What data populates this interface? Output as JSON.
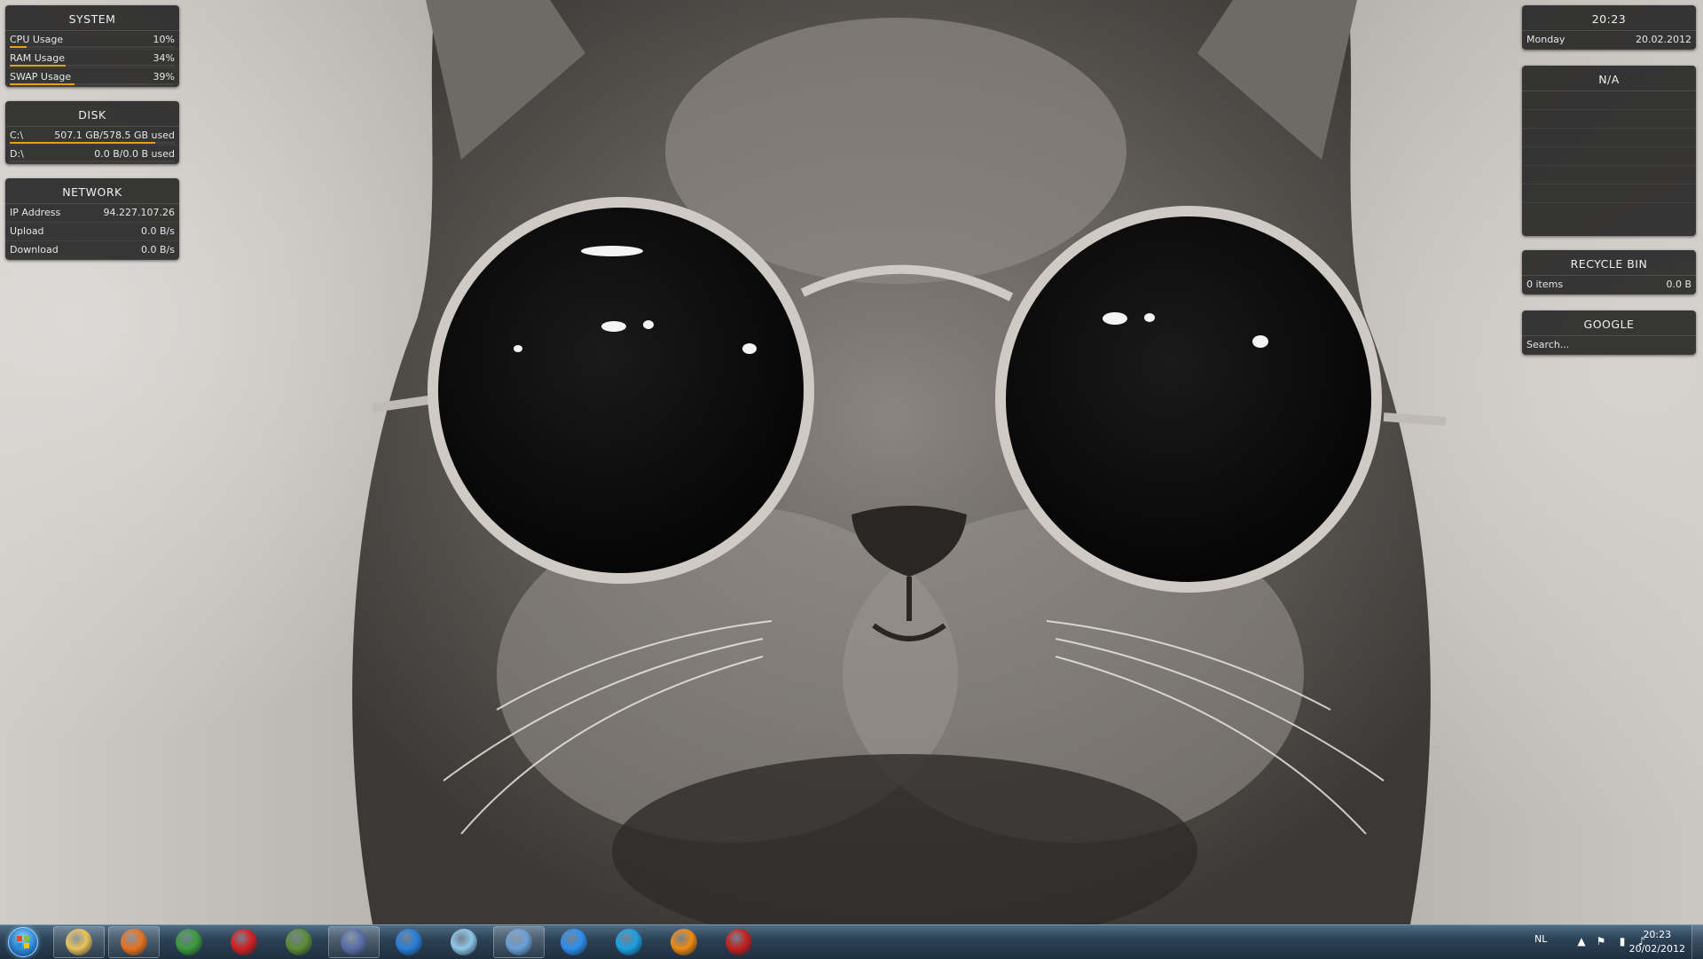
{
  "widgets": {
    "system": {
      "title": "SYSTEM",
      "rows": [
        {
          "label": "CPU Usage",
          "value": "10%",
          "fraction": 0.1
        },
        {
          "label": "RAM Usage",
          "value": "34%",
          "fraction": 0.34
        },
        {
          "label": "SWAP Usage",
          "value": "39%",
          "fraction": 0.39
        }
      ]
    },
    "disk": {
      "title": "DISK",
      "rows": [
        {
          "label": "C:\\",
          "value": "507.1 GB/578.5 GB used",
          "fraction": 0.88
        },
        {
          "label": "D:\\",
          "value": "0.0 B/0.0 B used",
          "fraction": 0.0
        }
      ]
    },
    "network": {
      "title": "NETWORK",
      "rows": [
        {
          "label": "IP Address",
          "value": "94.227.107.26"
        },
        {
          "label": "Upload",
          "value": "0.0 B/s"
        },
        {
          "label": "Download",
          "value": "0.0 B/s"
        }
      ]
    },
    "clock": {
      "time": "20:23",
      "day": "Monday",
      "date": "20.02.2012"
    },
    "weather": {
      "title": "N/A"
    },
    "recycle_bin": {
      "title": "RECYCLE BIN",
      "items": "0 items",
      "size": "0.0 B"
    },
    "google": {
      "title": "GOOGLE",
      "placeholder": "Search..."
    }
  },
  "taskbar": {
    "apps": [
      {
        "icon": "windows-explorer-icon",
        "color": "#e8c35a",
        "pinned_active": true
      },
      {
        "icon": "firefox-icon",
        "color": "#e8731f",
        "pinned_active": true
      },
      {
        "icon": "chrome-icon",
        "color": "#3c9a3c",
        "pinned_active": false
      },
      {
        "icon": "red-bird-icon",
        "color": "#d32020",
        "pinned_active": false
      },
      {
        "icon": "minecraft-icon",
        "color": "#5e8c35",
        "pinned_active": false
      },
      {
        "icon": "image-editor-icon",
        "color": "#5a6ea8",
        "pinned_active": true
      },
      {
        "icon": "blue-app-icon",
        "color": "#2a7fd8",
        "pinned_active": false
      },
      {
        "icon": "document-icon",
        "color": "#8fc6e8",
        "pinned_active": false
      },
      {
        "icon": "picture-viewer-icon",
        "color": "#6aa0d8",
        "pinned_active": true
      },
      {
        "icon": "itunes-icon",
        "color": "#2e8ff0",
        "pinned_active": false
      },
      {
        "icon": "skype-icon",
        "color": "#1ba1e2",
        "pinned_active": false
      },
      {
        "icon": "vlc-icon",
        "color": "#f08a12",
        "pinned_active": false
      },
      {
        "icon": "filezilla-icon",
        "color": "#c42020",
        "pinned_active": false
      }
    ],
    "tray": {
      "language": "NL",
      "time": "20:23",
      "date": "20/02/2012"
    }
  },
  "colors": {
    "accent": "#e0a415",
    "widget_bg": "#1c1c1c",
    "taskbar": "#2d4256"
  }
}
